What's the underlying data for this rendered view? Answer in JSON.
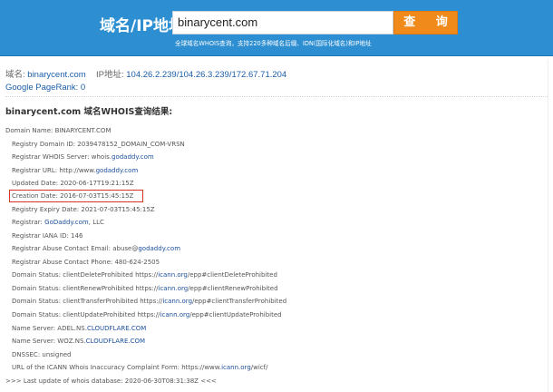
{
  "header": {
    "label": "域名/IP地址:",
    "search_value": "binarycent.com",
    "query_button": "查 询",
    "subtitle": "全球域名WHOIS查询，支持220多种域名后缀、IDN(国际化域名)和IP地址"
  },
  "info": {
    "domain_label": "域名:",
    "domain_value": "binarycent.com",
    "ip_label": "IP地址:",
    "ip_value": "104.26.2.239/104.26.3.239/172.67.71.204",
    "pagerank_label": "Google PageRank:",
    "pagerank_value": "0"
  },
  "result_title": "binarycent.com 域名WHOIS查询结果:",
  "whois": {
    "domain_name": "Domain Name: BINARYCENT.COM",
    "registry_domain_id": "Registry Domain ID: 2039478152_DOMAIN_COM-VRSN",
    "whois_server_prefix": "Registrar WHOIS Server: whois.",
    "whois_server_link": "godaddy.com",
    "registrar_url_prefix": "Registrar URL: http://www.",
    "registrar_url_link": "godaddy.com",
    "updated_date": "Updated Date: 2020-06-17T19:21:15Z",
    "creation_date": "Creation Date: 2016-07-03T15:45:15Z",
    "expiry_date": "Registry Expiry Date: 2021-07-03T15:45:15Z",
    "registrar_prefix": "Registrar: ",
    "registrar_link": "GoDaddy.com",
    "registrar_suffix": ", LLC",
    "iana_id": "Registrar IANA ID: 146",
    "abuse_email_prefix": "Registrar Abuse Contact Email: abuse@",
    "abuse_email_link": "godaddy.com",
    "abuse_phone": "Registrar Abuse Contact Phone: 480-624-2505",
    "status_1_prefix": "Domain Status: clientDeleteProhibited https://",
    "status_1_link": "icann.org",
    "status_1_suffix": "/epp#clientDeleteProhibited",
    "status_2_prefix": "Domain Status: clientRenewProhibited https://",
    "status_2_link": "icann.org",
    "status_2_suffix": "/epp#clientRenewProhibited",
    "status_3_prefix": "Domain Status: clientTransferProhibited https://",
    "status_3_link": "icann.org",
    "status_3_suffix": "/epp#clientTransferProhibited",
    "status_4_prefix": "Domain Status: clientUpdateProhibited https://",
    "status_4_link": "icann.org",
    "status_4_suffix": "/epp#clientUpdateProhibited",
    "ns_1_prefix": "Name Server: ADEL.NS.",
    "ns_1_link": "CLOUDFLARE.COM",
    "ns_2_prefix": "Name Server: WOZ.NS.",
    "ns_2_link": "CLOUDFLARE.COM",
    "dnssec": "DNSSEC: unsigned",
    "complaint_prefix": "URL of the ICANN Whois Inaccuracy Complaint Form: https://www.",
    "complaint_link": "icann.org",
    "complaint_suffix": "/wicf/",
    "last_update": ">>> Last update of whois database: 2020-06-30T08:31:38Z <<<"
  },
  "colors": {
    "header_bg": "#2d8fd1",
    "query_button": "#f08a1a",
    "link": "#1b4f9c",
    "highlight_border": "#d9342b"
  }
}
